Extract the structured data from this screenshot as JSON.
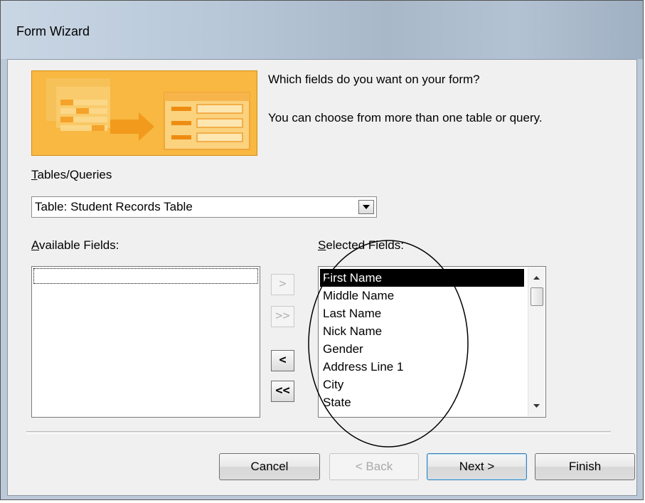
{
  "window": {
    "title": "Form Wizard"
  },
  "prompt": {
    "line1": "Which fields do you want on your form?",
    "line2": "You can choose from more than one table or query."
  },
  "tables_queries": {
    "label": "Tables/Queries",
    "accesskey": "T",
    "selected": "Table: Student Records Table"
  },
  "available_fields": {
    "label": "Available Fields:",
    "accesskey": "A",
    "items": []
  },
  "selected_fields": {
    "label": "Selected Fields:",
    "accesskey": "S",
    "items": [
      "First Name",
      "Middle Name",
      "Last Name",
      "Nick Name",
      "Gender",
      "Address Line 1",
      "City",
      "State"
    ],
    "selected_item": "First Name"
  },
  "move_buttons": {
    "add_one": ">",
    "add_all": ">>",
    "remove_one": "<",
    "remove_all": "<<"
  },
  "footer": {
    "cancel": "Cancel",
    "back": "< Back",
    "next": "Next >",
    "finish": "Finish"
  },
  "colors": {
    "banner": "#f7b53b",
    "banner_dark": "#e48f1c",
    "selection": "#000000",
    "default_button_border": "#3c7fb1"
  },
  "icons": {
    "combo_arrow": "chevron-down-icon",
    "scroll_up": "scroll-up-arrow-icon",
    "scroll_down": "scroll-down-arrow-icon",
    "banner": "table-to-form-illustration"
  }
}
